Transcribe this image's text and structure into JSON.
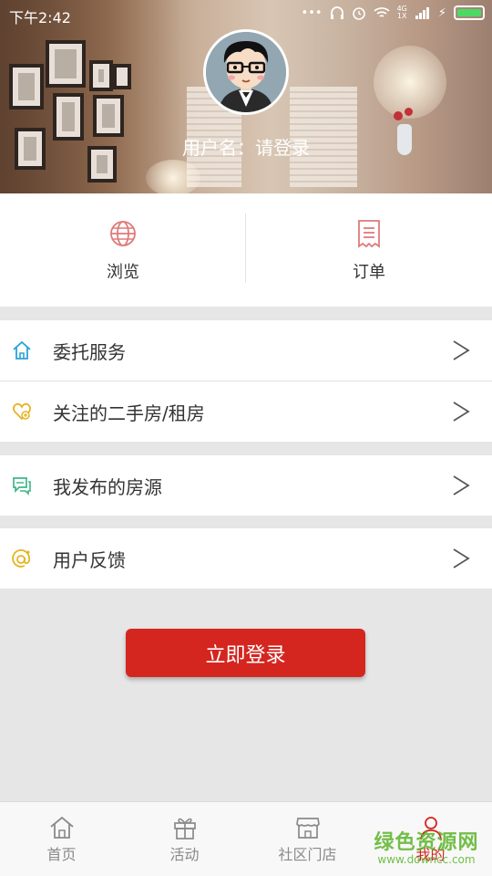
{
  "status_bar": {
    "time": "下午2:42",
    "network": "4G",
    "network_sub": "1X"
  },
  "profile": {
    "username": "用户名：请登录"
  },
  "quick_actions": [
    {
      "label": "浏览",
      "icon": "globe-icon"
    },
    {
      "label": "订单",
      "icon": "receipt-icon"
    }
  ],
  "menu": [
    {
      "label": "委托服务",
      "icon": "home-icon",
      "color": "#2aa3d8"
    },
    {
      "label": "关注的二手房/租房",
      "icon": "heart-icon",
      "color": "#e6b422"
    },
    {
      "label": "我发布的房源",
      "icon": "chat-icon",
      "color": "#3fb58a"
    },
    {
      "label": "用户反馈",
      "icon": "at-icon",
      "color": "#e6b422"
    }
  ],
  "login_button": "立即登录",
  "bottom_nav": [
    {
      "label": "首页",
      "icon": "home-icon"
    },
    {
      "label": "活动",
      "icon": "gift-icon"
    },
    {
      "label": "社区门店",
      "icon": "store-icon"
    },
    {
      "label": "我的",
      "icon": "person-icon",
      "active": true
    }
  ],
  "watermark": {
    "title": "绿色资源网",
    "url": "www.downcc.com"
  },
  "colors": {
    "accent": "#d4261f",
    "menu_bg": "#ffffff",
    "page_bg": "#e6e6e6"
  }
}
